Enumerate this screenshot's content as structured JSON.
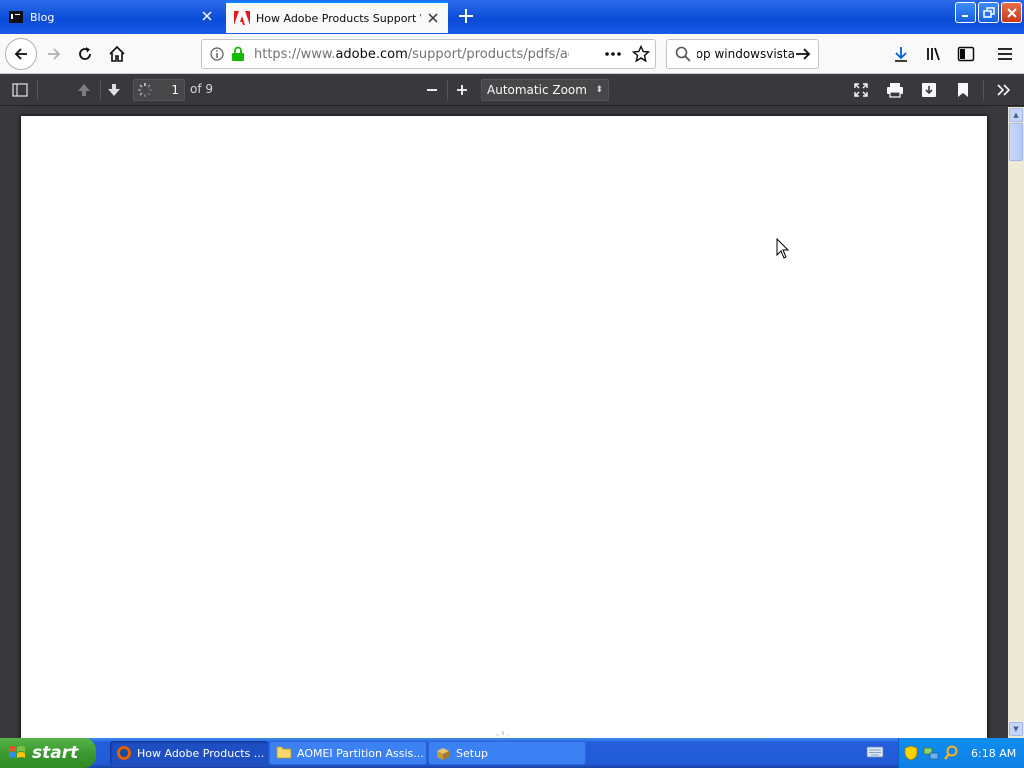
{
  "tabs": [
    {
      "title": "Blog",
      "active": false
    },
    {
      "title": "How Adobe Products Support Windows Vista",
      "active": true
    }
  ],
  "urlbar": {
    "url_prefix": "https://www.",
    "url_host": "adobe.com",
    "url_path": "/support/products/pdfs/adobe_"
  },
  "searchbar": {
    "value": "adobe photoshop windowsvista"
  },
  "pdf_toolbar": {
    "page_number": "1",
    "page_count": "of 9",
    "zoom": "Automatic Zoom"
  },
  "taskbar": {
    "start_label": "start",
    "tasks": [
      {
        "label": "How Adobe Products ...",
        "active": true
      },
      {
        "label": "AOMEI Partition Assis...",
        "active": false
      },
      {
        "label": "Setup",
        "active": false
      }
    ],
    "clock": "6:18 AM"
  },
  "colors": {
    "xp_blue": "#245ddb",
    "firefox_toolbar": "#f9f9fa",
    "pdf_bg": "#38383d",
    "accent": "#0a84ff",
    "start_green": "#3a9a2f"
  }
}
